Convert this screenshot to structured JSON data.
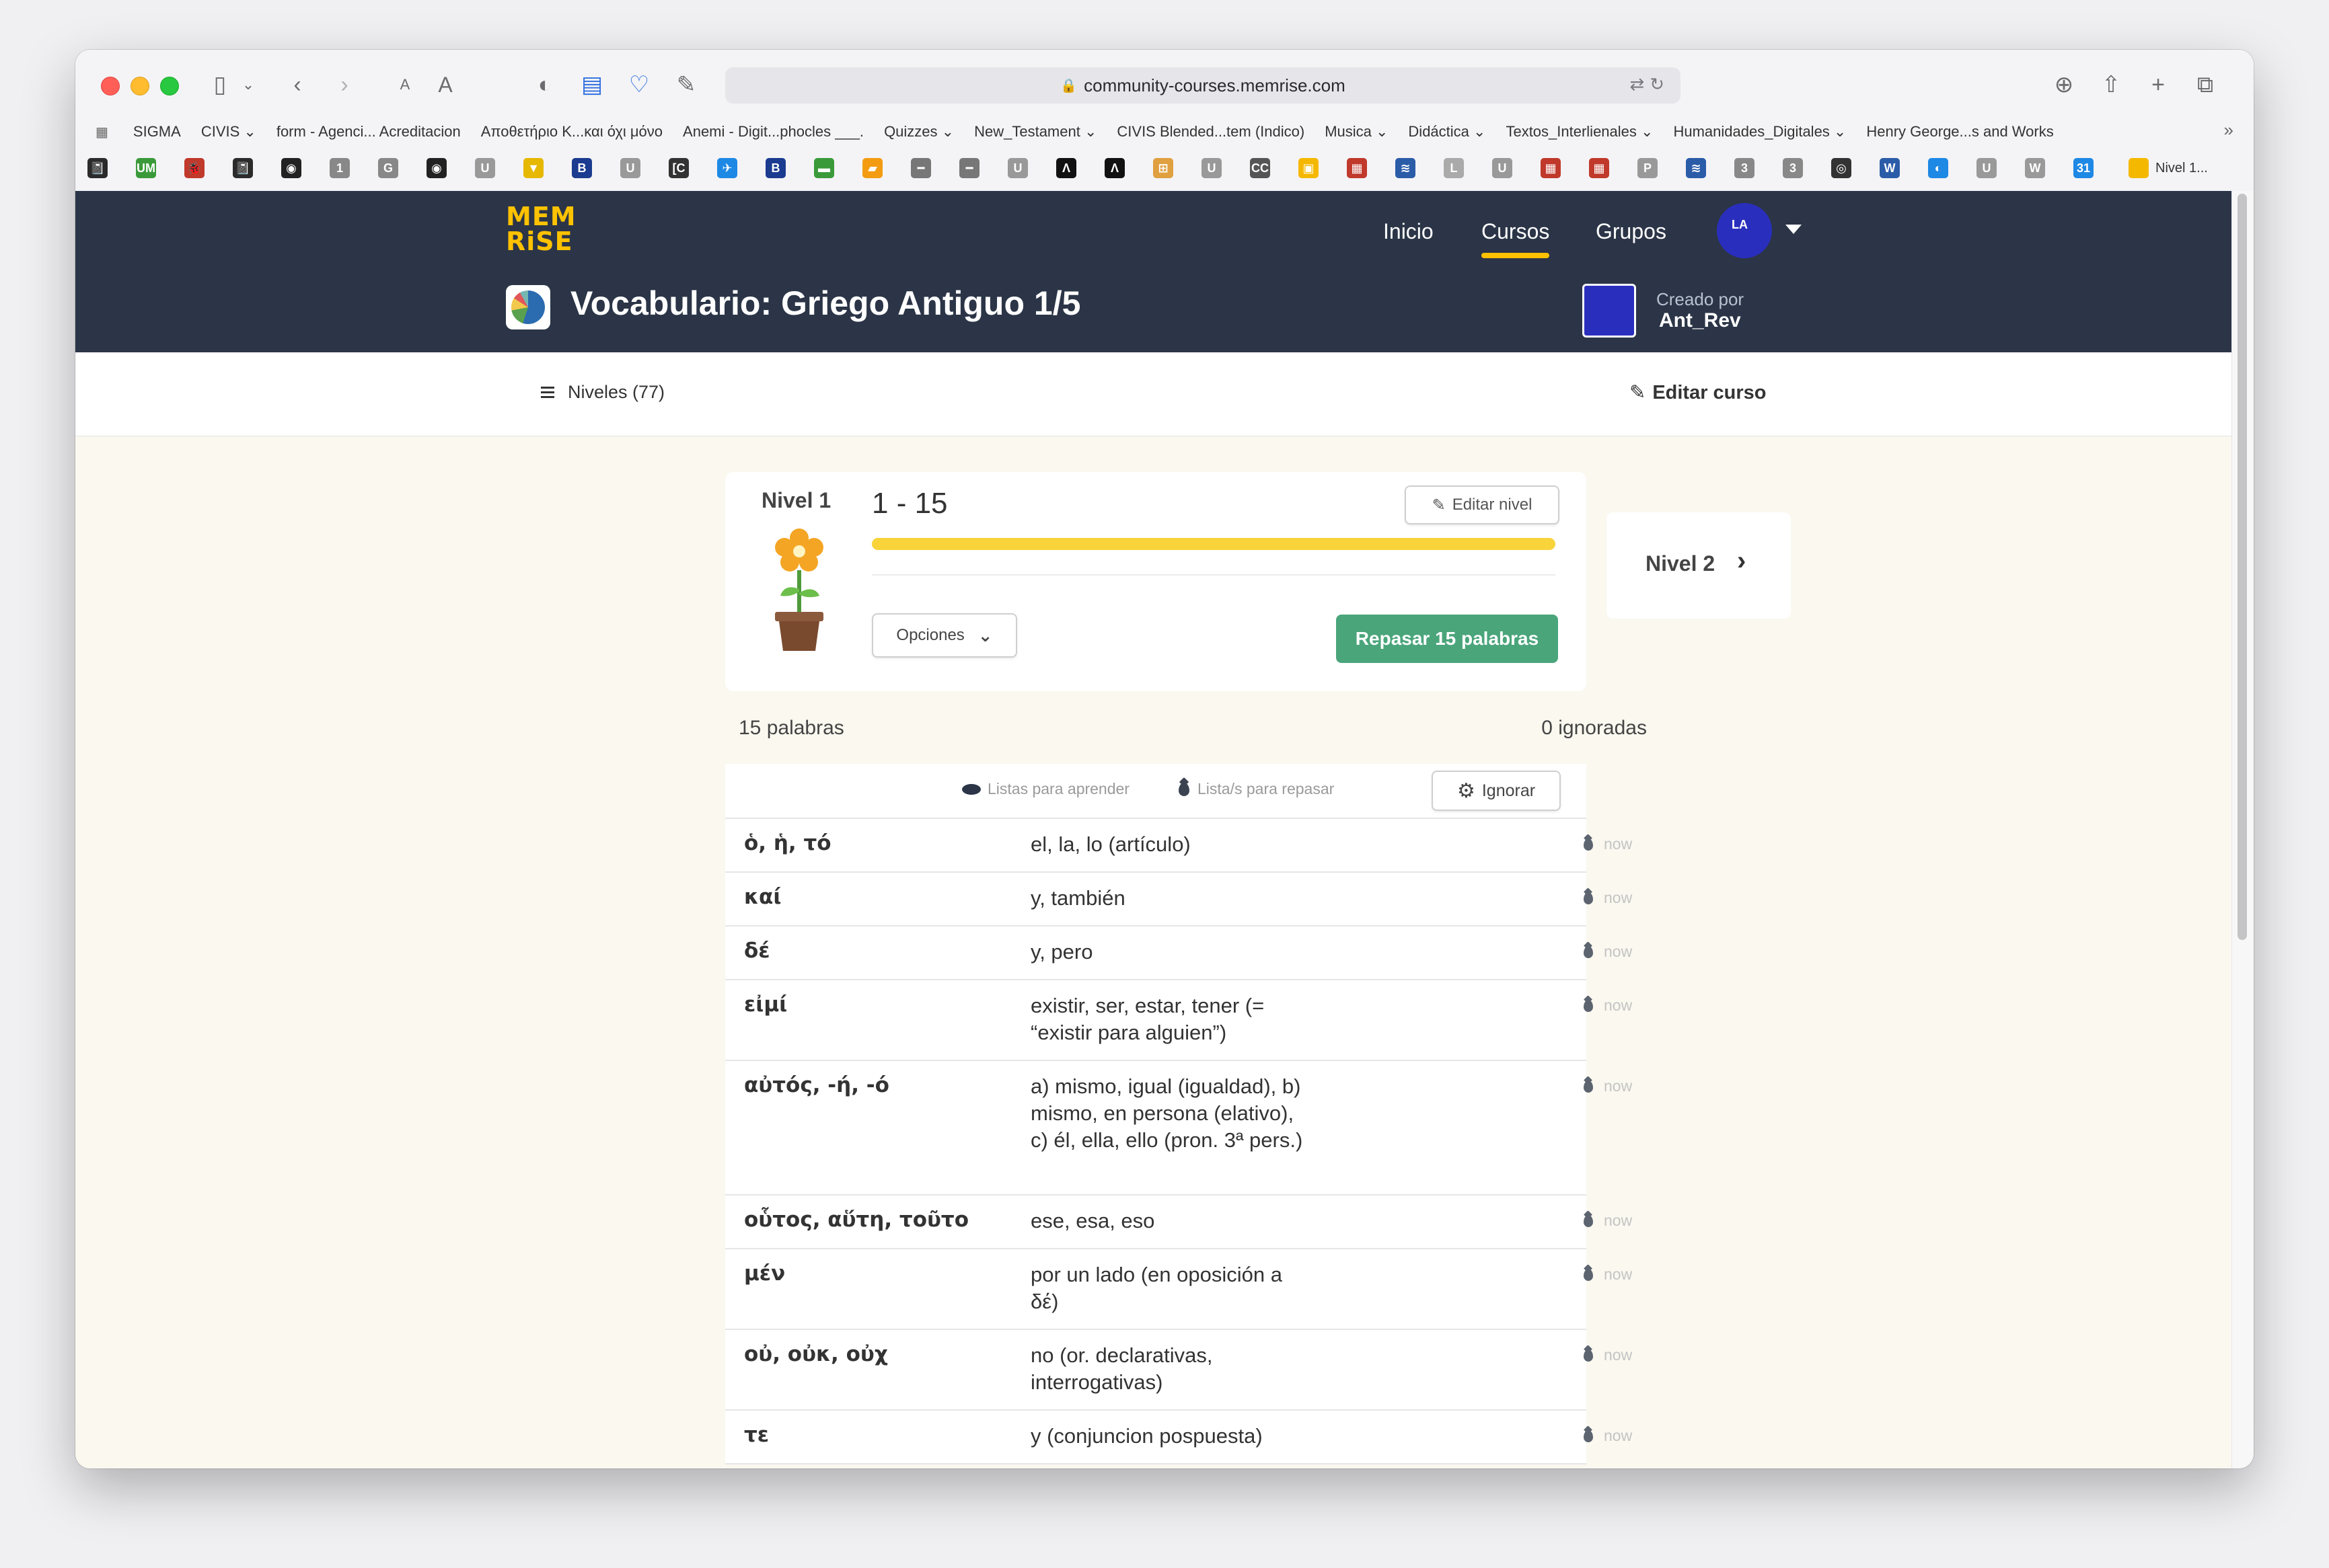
{
  "browser": {
    "url": "community-courses.memrise.com",
    "bookmarks": [
      "SIGMA",
      "CIVIS ⌄",
      "form - Agenci... Acreditacion",
      "Αποθετήριο Κ...και όχι μόνο",
      "Anemi - Digit...phocles ___.",
      "Quizzes ⌄",
      "New_Testament ⌄",
      "CIVIS Blended...tem (Indico)",
      "Musica ⌄",
      "Didáctica ⌄",
      "Textos_Interlienales ⌄",
      "Humanidades_Digitales ⌄",
      "Henry George...s and Works"
    ],
    "favicons": [
      "📓",
      "UM",
      "🐞",
      "📓",
      "◉",
      "1",
      "G",
      "◉",
      "U",
      "▼",
      "B",
      "U",
      "[C",
      "✈",
      "B",
      "▬",
      "▰",
      "━",
      "━",
      "U",
      "Λ",
      "Λ",
      "⊞",
      "U",
      "CC",
      "▣",
      "▦",
      "≋",
      "L",
      "U",
      "▦",
      "▦",
      "P",
      "≋",
      "3",
      "3",
      "◎",
      "W",
      "◐",
      "U",
      "W",
      "31"
    ],
    "favicon_colors": [
      "#2b2b2b",
      "#3a9a3a",
      "#c0392b",
      "#2b2b2b",
      "#222",
      "#888",
      "#888",
      "#222",
      "#999",
      "#e6b800",
      "#1a3b8f",
      "#999",
      "#333",
      "#1e88e5",
      "#1a3b8f",
      "#3a9a3a",
      "#f39c12",
      "#777",
      "#777",
      "#999",
      "#111",
      "#111",
      "#e0a040",
      "#999",
      "#555",
      "#f5b800",
      "#c0392b",
      "#2b5ca8",
      "#aaa",
      "#999",
      "#c0392b",
      "#c0392b",
      "#999",
      "#2b5ca8",
      "#888",
      "#888",
      "#333",
      "#2b5ca8",
      "#1e88e5",
      "#999",
      "#999",
      "#1e88e5"
    ],
    "last_tab_label": "Nivel 1..."
  },
  "header": {
    "logo_line1": "MEM",
    "logo_line2": "RiSE",
    "nav": [
      "Inicio",
      "Cursos",
      "Grupos"
    ],
    "active_nav": "Cursos",
    "course_title": "Vocabulario: Griego Antiguo 1/5",
    "created_by_label": "Creado por",
    "creator_name": "Ant_Rev"
  },
  "subbar": {
    "levels_label": "Niveles (77)",
    "edit_course_label": "Editar curso"
  },
  "level": {
    "label": "Nivel 1",
    "range": "1 - 15",
    "progress": 1.0,
    "edit_level_label": "Editar nivel",
    "options_label": "Opciones",
    "review_label": "Repasar 15 palabras",
    "next_label": "Nivel 2"
  },
  "words": {
    "count_label": "15 palabras",
    "ignored_label": "0 ignoradas",
    "legend_learn": "Listas para aprender",
    "legend_review": "Lista/s para repasar",
    "ignore_button": "Ignorar",
    "rows": [
      {
        "word": "ὁ, ἡ, τό",
        "def": "el, la, lo (artículo)",
        "status": "now"
      },
      {
        "word": "καί",
        "def": "y, también",
        "status": "now"
      },
      {
        "word": "δέ",
        "def": "y, pero",
        "status": "now"
      },
      {
        "word": "εἰμί",
        "def": "existir, ser, estar, tener (= “existir para alguien”)",
        "status": "now"
      },
      {
        "word": "αὐτός, -ή, -ό",
        "def": "a) mismo, igual (igualdad), b) mismo, en persona (elativo), c) él, ella, ello (pron. 3ª pers.)",
        "status": "now"
      },
      {
        "word": "οὗτος, αὕτη, τοῦτο",
        "def": "ese, esa, eso",
        "status": "now"
      },
      {
        "word": "μέν",
        "def": "por un lado (en oposición a δέ)",
        "status": "now"
      },
      {
        "word": "οὐ, οὐκ, οὐχ",
        "def": "no (or. declarativas, interrogativas)",
        "status": "now"
      },
      {
        "word": "τε",
        "def": "y (conjuncion pospuesta)",
        "status": "now"
      }
    ]
  },
  "colors": {
    "header_bg": "#2b3547",
    "accent_yellow": "#ffc200",
    "review_green": "#4aa57b",
    "page_bg": "#faf8ef"
  }
}
